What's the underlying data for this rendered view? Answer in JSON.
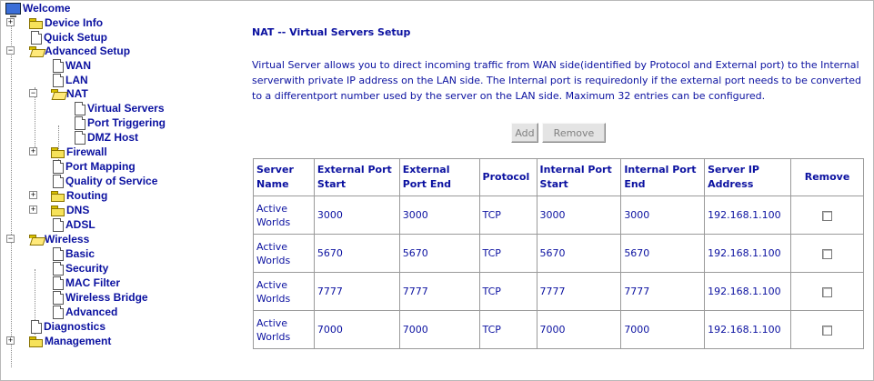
{
  "nav": {
    "welcome": "Welcome",
    "device_info": "Device Info",
    "quick_setup": "Quick Setup",
    "advanced_setup": "Advanced Setup",
    "wan": "WAN",
    "lan": "LAN",
    "nat": "NAT",
    "virtual_servers": "Virtual Servers",
    "port_triggering": "Port Triggering",
    "dmz_host": "DMZ Host",
    "firewall": "Firewall",
    "port_mapping": "Port Mapping",
    "quality_of_service": "Quality of Service",
    "routing": "Routing",
    "dns": "DNS",
    "adsl": "ADSL",
    "wireless": "Wireless",
    "basic": "Basic",
    "security": "Security",
    "mac_filter": "MAC Filter",
    "wireless_bridge": "Wireless Bridge",
    "advanced": "Advanced",
    "diagnostics": "Diagnostics",
    "management": "Management"
  },
  "page": {
    "title": "NAT -- Virtual Servers Setup",
    "description": "Virtual Server allows you to direct incoming traffic from WAN side(identified by Protocol and External port) to the Internal serverwith private IP address on the LAN side. The Internal port is requiredonly if the external port needs to be converted to a differentport number used by the server on the LAN side. Maximum 32 entries can be configured."
  },
  "buttons": {
    "add": "Add",
    "remove": "Remove"
  },
  "table": {
    "headers": {
      "server_name": "Server Name",
      "external_port_start": "External Port Start",
      "external_port_end": "External Port End",
      "protocol": "Protocol",
      "internal_port_start": "Internal Port Start",
      "internal_port_end": "Internal Port End",
      "server_ip_address": "Server IP Address",
      "remove": "Remove"
    },
    "rows": [
      {
        "server_name": "Active Worlds",
        "ext_start": "3000",
        "ext_end": "3000",
        "protocol": "TCP",
        "int_start": "3000",
        "int_end": "3000",
        "ip": "192.168.1.100"
      },
      {
        "server_name": "Active Worlds",
        "ext_start": "5670",
        "ext_end": "5670",
        "protocol": "TCP",
        "int_start": "5670",
        "int_end": "5670",
        "ip": "192.168.1.100"
      },
      {
        "server_name": "Active Worlds",
        "ext_start": "7777",
        "ext_end": "7777",
        "protocol": "TCP",
        "int_start": "7777",
        "int_end": "7777",
        "ip": "192.168.1.100"
      },
      {
        "server_name": "Active Worlds",
        "ext_start": "7000",
        "ext_end": "7000",
        "protocol": "TCP",
        "int_start": "7000",
        "int_end": "7000",
        "ip": "192.168.1.100"
      }
    ]
  }
}
